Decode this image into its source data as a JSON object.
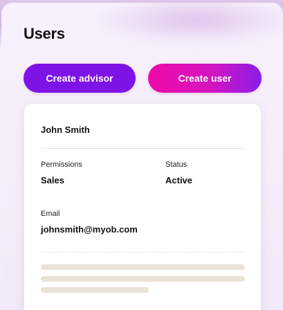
{
  "page": {
    "title": "Users"
  },
  "actions": {
    "create_advisor_label": "Create advisor",
    "create_user_label": "Create user"
  },
  "user_card": {
    "name": "John Smith",
    "permissions_label": "Permissions",
    "permissions_value": "Sales",
    "status_label": "Status",
    "status_value": "Active",
    "email_label": "Email",
    "email_value": "johnsmith@myob.com"
  },
  "colors": {
    "primary_purple": "#7e13e6",
    "gradient_pink": "#ef0aa9",
    "gradient_purple": "#8a1ee6",
    "skeleton": "#e9e2d8"
  }
}
